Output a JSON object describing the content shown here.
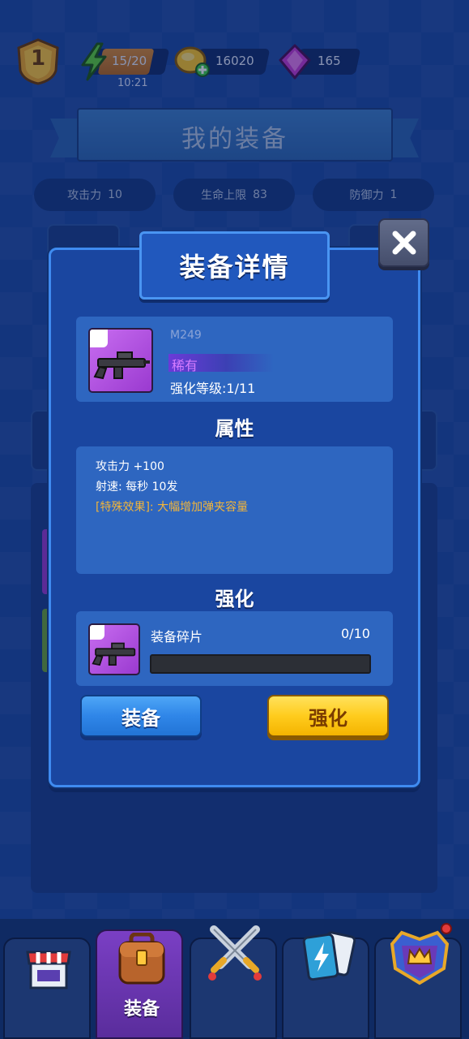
{
  "hud": {
    "level": "1",
    "energy": "15/20",
    "energy_fraction": 0.75,
    "energy_timer": "10:21",
    "coins": "16020",
    "gems": "165"
  },
  "page": {
    "title": "我的装备"
  },
  "stats": [
    {
      "label": "攻击力",
      "value": "10"
    },
    {
      "label": "生命上限",
      "value": "83"
    },
    {
      "label": "防御力",
      "value": "1"
    }
  ],
  "modal": {
    "title": "装备详情",
    "item": {
      "name": "M249",
      "rarity": "稀有",
      "rarity_color": "#d57bff",
      "enhance_level": "强化等级:1/11"
    },
    "attributes_heading": "属性",
    "attributes": [
      "攻击力 +100",
      "射速: 每秒 10发",
      "[特殊效果]: 大幅增加弹夹容量"
    ],
    "upgrade_heading": "强化",
    "shards": {
      "label": "装备碎片",
      "count": "0/10",
      "progress": 0
    },
    "equip_button": "装备",
    "upgrade_button": "强化"
  },
  "nav": {
    "tabs": [
      {
        "icon": "shop-icon",
        "label": ""
      },
      {
        "icon": "backpack-icon",
        "label": "装备",
        "active": true
      },
      {
        "icon": "crossed-swords-icon",
        "label": ""
      },
      {
        "icon": "cards-icon",
        "label": ""
      },
      {
        "icon": "crown-shield-icon",
        "label": ""
      }
    ]
  }
}
